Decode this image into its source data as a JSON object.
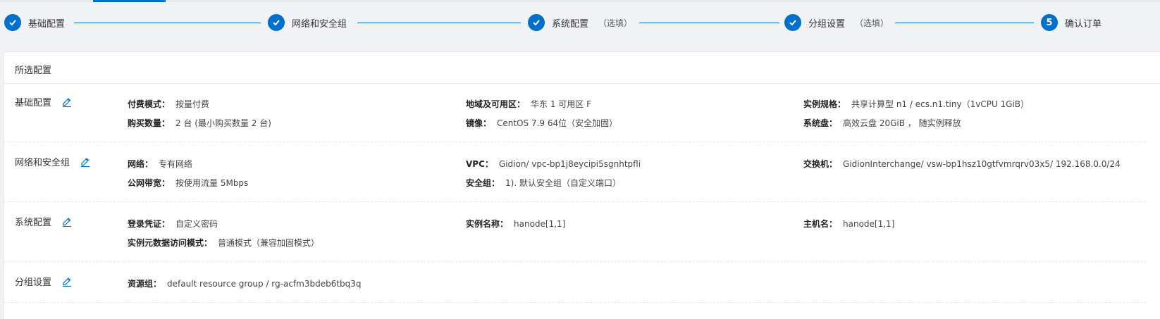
{
  "steps": [
    {
      "label": "基础配置",
      "optional": "",
      "state": "done"
    },
    {
      "label": "网络和安全组",
      "optional": "",
      "state": "done"
    },
    {
      "label": "系统配置",
      "optional": "（选填）",
      "state": "done"
    },
    {
      "label": "分组设置",
      "optional": "（选填）",
      "state": "done"
    },
    {
      "label": "确认订单",
      "optional": "",
      "state": "current",
      "number": "5"
    }
  ],
  "colors": {
    "accent": "#0070cc"
  },
  "panel": {
    "title": "所选配置"
  },
  "sections": {
    "basic": {
      "title": "基础配置",
      "items": [
        {
          "key": "付费模式：",
          "value": "按量付费"
        },
        {
          "key": "地域及可用区：",
          "value": "华东 1 可用区 F"
        },
        {
          "key": "实例规格：",
          "value": "共享计算型 n1 / ecs.n1.tiny（1vCPU 1GiB）"
        },
        {
          "key": "购买数量：",
          "value": "2 台 (最小购买数量 2 台)"
        },
        {
          "key": "镜像：",
          "value": "CentOS 7.9 64位（安全加固）"
        },
        {
          "key": "系统盘：",
          "value": "高效云盘 20GiB ， 随实例释放"
        }
      ]
    },
    "network": {
      "title": "网络和安全组",
      "items": [
        {
          "key": "网络：",
          "value": "专有网络"
        },
        {
          "key": "VPC：",
          "value": "Gidion/ vpc-bp1j8eycipi5sgnhtpfli"
        },
        {
          "key": "交换机：",
          "value": "GidionInterchange/ vsw-bp1hsz10gtfvmrqrv03x5/ 192.168.0.0/24"
        },
        {
          "key": "公网带宽：",
          "value": "按使用流量 5Mbps"
        },
        {
          "key": "安全组：",
          "value": "1). 默认安全组（自定义端口）"
        }
      ]
    },
    "system": {
      "title": "系统配置",
      "items": [
        {
          "key": "登录凭证：",
          "value": "自定义密码"
        },
        {
          "key": "实例名称：",
          "value": "hanode[1,1]"
        },
        {
          "key": "主机名：",
          "value": "hanode[1,1]"
        },
        {
          "key": "实例元数据访问模式：",
          "value": "普通模式（兼容加固模式）"
        }
      ]
    },
    "group": {
      "title": "分组设置",
      "items": [
        {
          "key": "资源组：",
          "value": "default resource group / rg-acfm3bdeb6tbq3q"
        }
      ]
    }
  }
}
